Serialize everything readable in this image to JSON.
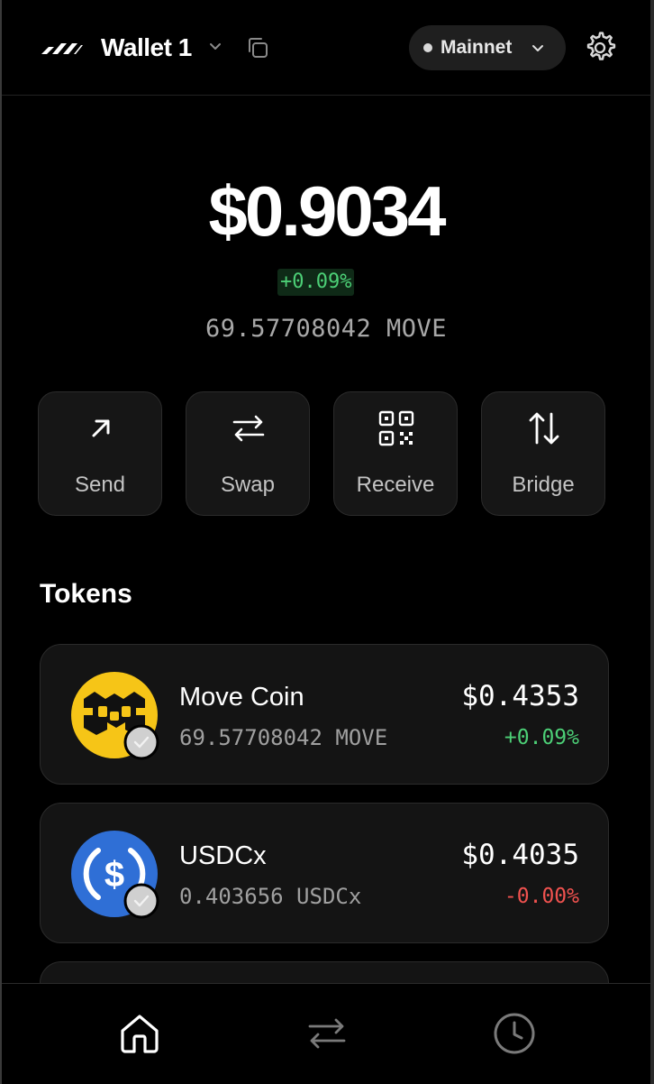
{
  "header": {
    "wallet_name": "Wallet 1",
    "network": "Mainnet"
  },
  "balance": {
    "usd": "$0.9034",
    "change": "+0.09%",
    "native": "69.57708042 MOVE"
  },
  "actions": [
    {
      "label": "Send",
      "icon": "arrow-up-right-icon"
    },
    {
      "label": "Swap",
      "icon": "swap-icon"
    },
    {
      "label": "Receive",
      "icon": "qr-code-icon"
    },
    {
      "label": "Bridge",
      "icon": "bridge-icon"
    }
  ],
  "tokens_section": {
    "title": "Tokens",
    "items": [
      {
        "name": "Move Coin",
        "amount": "69.57708042 MOVE",
        "value": "$0.4353",
        "change": "+0.09%",
        "change_color": "#4ccf76",
        "logo": "move-coin-logo",
        "logo_color": "#f6c517"
      },
      {
        "name": "USDCx",
        "amount": "0.403656 USDCx",
        "value": "$0.4035",
        "change": "-0.00%",
        "change_color": "#f0524f",
        "logo": "usdc-logo",
        "logo_color": "#2f6fd6"
      }
    ]
  },
  "nav": {
    "items": [
      {
        "icon": "home-icon",
        "active": true
      },
      {
        "icon": "transfer-icon",
        "active": false
      },
      {
        "icon": "history-icon",
        "active": false
      }
    ]
  },
  "colors": {
    "background": "#000000",
    "card": "#141414",
    "positive": "#4ccf76",
    "negative": "#f0524f"
  }
}
